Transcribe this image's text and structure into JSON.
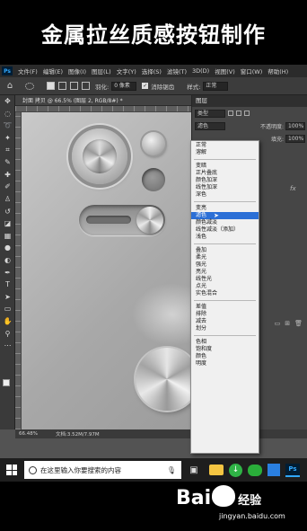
{
  "title": "金属拉丝质感按钮制作",
  "menubar": {
    "logo": "Ps",
    "items": [
      "文件(F)",
      "编辑(E)",
      "图像(I)",
      "图层(L)",
      "文字(Y)",
      "选择(S)",
      "滤镜(T)",
      "3D(D)",
      "视图(V)",
      "窗口(W)",
      "帮助(H)"
    ]
  },
  "options": {
    "feather_label": "羽化:",
    "feather_value": "0 像素",
    "antialias_label": "消除锯齿",
    "style_label": "样式:",
    "style_value": "正常"
  },
  "document": {
    "tab_title": "封面 拷贝 @ 66.5% (图层 2, RGB/8#) *",
    "zoom": "66.48%",
    "doc_size": "文档:3.52M/7.97M"
  },
  "layers_panel": {
    "tab": "图层",
    "kind_filter": "类型",
    "blend_mode": "滤色",
    "opacity_label": "不透明度:",
    "opacity_value": "100%",
    "fill_label": "填充:",
    "fill_value": "100%",
    "fx": "fx"
  },
  "blend_menu": {
    "groups": [
      [
        "正常",
        "溶解"
      ],
      [
        "变暗",
        "正片叠底",
        "颜色加深",
        "线性加深",
        "深色"
      ],
      [
        "变亮",
        "滤色",
        "颜色减淡",
        "线性减淡（添加）",
        "浅色"
      ],
      [
        "叠加",
        "柔光",
        "强光",
        "亮光",
        "线性光",
        "点光",
        "实色混合"
      ],
      [
        "差值",
        "排除",
        "减去",
        "划分"
      ],
      [
        "色相",
        "饱和度",
        "颜色",
        "明度"
      ]
    ],
    "selected": "滤色"
  },
  "taskbar": {
    "search_placeholder": "在这里输入你要搜索的内容",
    "ps_label": "Ps"
  },
  "watermark": {
    "brand_left": "Bai",
    "brand_right": "经验",
    "url": "jingyan.baidu.com"
  }
}
